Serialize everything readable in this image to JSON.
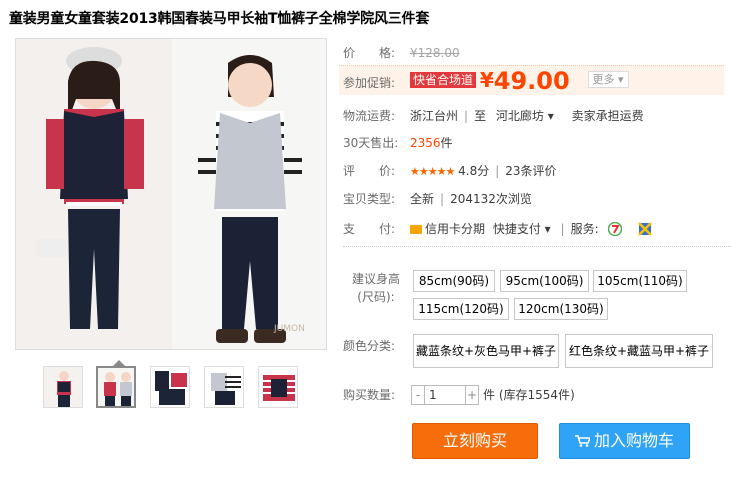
{
  "product": {
    "title": "童装男童女童套装2013韩国春装马甲长袖T恤裤子全棉学院风三件套"
  },
  "gallery": {
    "thumb_count": 5,
    "active_index": 1,
    "watermark_left": "JUMON",
    "watermark_right": "JUMON"
  },
  "price_row": {
    "label": "价　　格:",
    "value": "¥128.00"
  },
  "promo_row": {
    "label": "参加促销:",
    "tag": "快省合场道",
    "currency": "¥",
    "price": "49.00",
    "more": "更多 ▾"
  },
  "shipping_row": {
    "label": "物流运费:",
    "from": "浙江台州",
    "sep": "至",
    "to": "河北廊坊 ▾",
    "note": "卖家承担运费"
  },
  "sales_row": {
    "label": "30天售出:",
    "count": "2356",
    "unit": "件"
  },
  "rating_row": {
    "label": "评　　价:",
    "stars": "★★★★★",
    "score": "4.8分",
    "reviews": "23条评价"
  },
  "type_row": {
    "label": "宝贝类型:",
    "condition": "全新",
    "views": "204132次浏览"
  },
  "pay_row": {
    "label": "支　　付:",
    "credit": "信用卡分期",
    "fast": "快捷支付 ▾",
    "service_label": "服务:"
  },
  "size_option": {
    "label_line1": "建议身高",
    "label_line2": "(尺码):",
    "values": [
      "85cm(90码)",
      "95cm(100码)",
      "105cm(110码)",
      "115cm(120码)",
      "120cm(130码)"
    ]
  },
  "color_option": {
    "label": "颜色分类:",
    "values": [
      "藏蓝条纹+灰色马甲+裤子",
      "红色条纹+藏蓝马甲+裤子"
    ]
  },
  "quantity": {
    "label": "购买数量:",
    "minus": "-",
    "value": "1",
    "plus": "+",
    "unit": "件",
    "stock": "(库存1554件)"
  },
  "actions": {
    "buy_now": "立刻购买",
    "add_to_cart": "加入购物车"
  },
  "colors": {
    "accent": "#ff4400",
    "buy_button": "#f86d0b",
    "cart_button": "#2fa3f5"
  }
}
